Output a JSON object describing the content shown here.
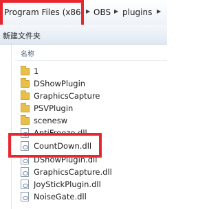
{
  "address_bar": {
    "crumbs": [
      "Program Files (x86)",
      "OBS",
      "plugins"
    ]
  },
  "toolbar": {
    "new_folder_label": "新建文件夹"
  },
  "columns": {
    "name": "名称"
  },
  "items": [
    {
      "name": "1",
      "type": "folder"
    },
    {
      "name": "DShowPlugin",
      "type": "folder"
    },
    {
      "name": "GraphicsCapture",
      "type": "folder"
    },
    {
      "name": "PSVPlugin",
      "type": "folder"
    },
    {
      "name": "scenesw",
      "type": "folder"
    },
    {
      "name": "AntiFreeze.dll",
      "type": "dll"
    },
    {
      "name": "CountDown.dll",
      "type": "dll"
    },
    {
      "name": "DShowPlugin.dll",
      "type": "dll"
    },
    {
      "name": "GraphicsCapture.dll",
      "type": "dll"
    },
    {
      "name": "JoyStickPlugin.dll",
      "type": "dll"
    },
    {
      "name": "NoiseGate.dll",
      "type": "dll"
    }
  ],
  "colors": {
    "highlight": "#e8262e",
    "folder": "#e8c049"
  }
}
